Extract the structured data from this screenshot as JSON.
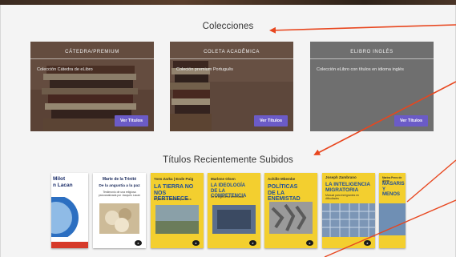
{
  "sections": {
    "collections_heading": "Colecciones",
    "recent_heading": "Títulos Recientemente Subidos"
  },
  "collections": [
    {
      "title": "CÁTEDRA/PREMIUM",
      "description": "Colección Cátedra de eLibro",
      "button_label": "Ver Títulos"
    },
    {
      "title": "COLETA ACADÊMICA",
      "description": "Coleción premium Português",
      "button_label": "Ver Títulos"
    },
    {
      "title": "ELIBRO INGLÉS",
      "description": "Colección eLibro con títulos en idioma inglés",
      "button_label": "Ver Títulos"
    }
  ],
  "books": [
    {
      "author": "",
      "title": "Milot\nn Lacan",
      "subtitle": ""
    },
    {
      "author": "Marie de la Trinité",
      "title": "De la angustia a la paz",
      "subtitle": "Testimonio de una religiosa psicoanalizada por Jacques Lacan"
    },
    {
      "author": "Yves Zarka | Ende Puig",
      "title": "LA TIERRA NO\nNOS PERTENECE",
      "subtitle": "Repensar el territorio y la tierra"
    },
    {
      "author": "Marlene Olsen",
      "title": "LA IDEOLOGÍA\nDE LA COMPETENCIA",
      "subtitle": "De la ingeniería al mercado"
    },
    {
      "author": "Achille Mbembe",
      "title": "POLÍTICAS\nDE LA ENEMISTAD",
      "subtitle": ""
    },
    {
      "author": "Joseph Zambrano",
      "title": "LA INTELIGENCIA\nMIGRATORIA",
      "subtitle": "Manual para inmigrantes en dificultades"
    },
    {
      "author": "Marina Perez de Arcos",
      "title": "MASARIS\nY MENOS",
      "subtitle": ""
    }
  ],
  "colors": {
    "accent_button": "#6b5bc7",
    "arrow": "#e8461e",
    "book_yellow": "#f3cf2f",
    "book_blue": "#1f4e9a"
  }
}
